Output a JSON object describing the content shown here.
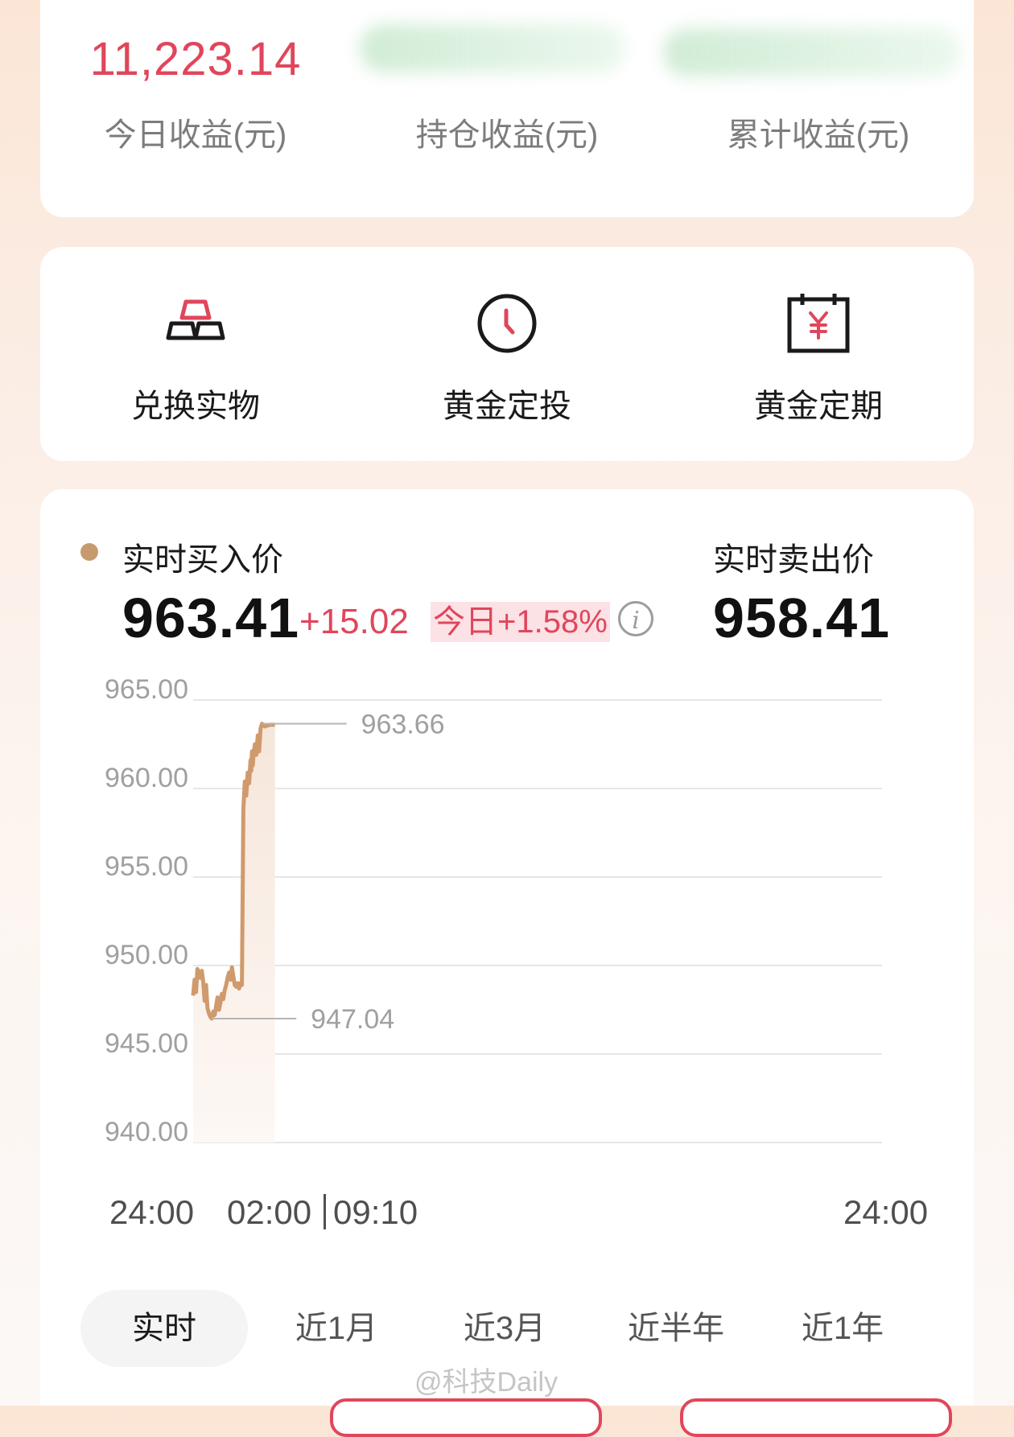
{
  "summary": {
    "today_value": "11,223.14",
    "today_label": "今日收益(元)",
    "holding_label": "持仓收益(元)",
    "total_label": "累计收益(元)"
  },
  "services": [
    {
      "label": "兑换实物",
      "icon": "gold-bars-icon"
    },
    {
      "label": "黄金定投",
      "icon": "clock-icon"
    },
    {
      "label": "黄金定期",
      "icon": "calendar-yen-icon"
    }
  ],
  "price": {
    "buy_label": "实时买入价",
    "buy_value": "963.41",
    "change": "+15.02",
    "change_pct": "今日+1.58%",
    "info_glyph": "i",
    "sell_label": "实时卖出价",
    "sell_value": "958.41"
  },
  "colors": {
    "accent_red": "#e0465b",
    "line_gold": "#d09a6c",
    "dot": "#c69a6e"
  },
  "chart_data": {
    "type": "line",
    "ylim": [
      940,
      965
    ],
    "yticks": [
      "965.00",
      "960.00",
      "955.00",
      "950.00",
      "945.00",
      "940.00"
    ],
    "grid": true,
    "xticks": [
      "24:00",
      "02:00",
      "09:10",
      "24:00"
    ],
    "max_annotation": "963.66",
    "min_annotation": "947.04",
    "series": [
      {
        "x": [
          0,
          2,
          4,
          6,
          8,
          10,
          12,
          14,
          16,
          18,
          20,
          22,
          24,
          26,
          28,
          30,
          32,
          34,
          36,
          38,
          40,
          42,
          44,
          46,
          48,
          50,
          52,
          54,
          56,
          58,
          60,
          62,
          64,
          66,
          68,
          70,
          72,
          74,
          76,
          78,
          80,
          81,
          82,
          83,
          84,
          86,
          88,
          90,
          92,
          94,
          96,
          98,
          100,
          102,
          104,
          106,
          108,
          110,
          112,
          114
        ],
        "y": [
          948.3,
          949.2,
          948.5,
          949.8,
          949.6,
          949.3,
          949.7,
          949.1,
          948.0,
          948.9,
          947.6,
          947.3,
          947.1,
          947.0,
          947.4,
          947.2,
          947.7,
          948.2,
          947.5,
          947.9,
          948.4,
          948.1,
          948.6,
          948.9,
          949.3,
          949.6,
          949.2,
          949.9,
          949.4,
          948.9,
          948.8,
          949.0,
          948.7,
          949.0,
          948.9,
          958.8,
          960.4,
          959.6,
          960.9,
          960.3,
          961.6,
          961.0,
          962.1,
          961.3,
          961.8,
          962.5,
          961.9,
          963.0,
          962.1,
          963.4,
          963.66,
          963.6,
          963.5,
          963.6,
          963.55,
          963.6,
          963.6,
          963.6,
          963.6,
          963.6
        ]
      }
    ]
  },
  "periods": {
    "tab_realtime": "实时",
    "tab_1m": "近1月",
    "tab_3m": "近3月",
    "tab_6m": "近半年",
    "tab_1y": "近1年"
  },
  "watermark": "@科技Daily"
}
